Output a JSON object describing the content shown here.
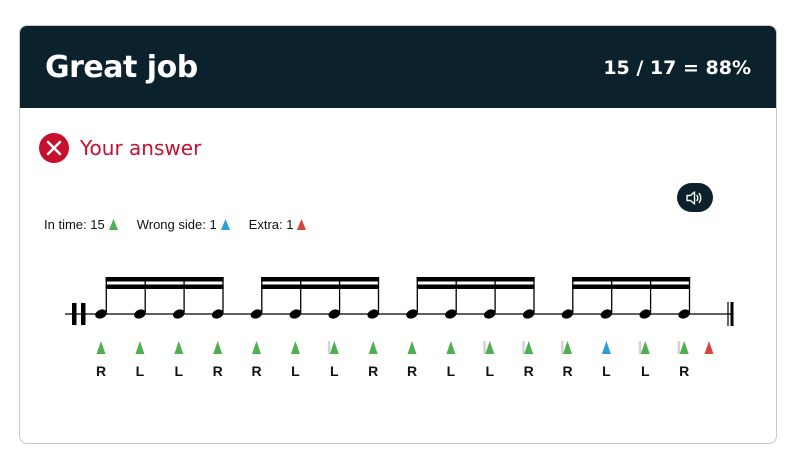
{
  "header": {
    "title": "Great job",
    "score": "15 / 17 = 88%"
  },
  "result": {
    "label": "Your answer",
    "status": "incorrect"
  },
  "legend": {
    "in_time": {
      "label": "In time: 15",
      "color": "#4caf50"
    },
    "wrong_side": {
      "label": "Wrong side: 1",
      "color": "#2a9fd6"
    },
    "extra": {
      "label": "Extra: 1",
      "color": "#d9453d"
    }
  },
  "sound_button": {
    "icon": "speaker-icon"
  },
  "colors": {
    "header_bg": "#0b212c",
    "error_red": "#c8102e",
    "in_time_green": "#4caf50",
    "wrong_side_blue": "#2a9fd6",
    "extra_red": "#d9453d"
  },
  "notation": {
    "beats": 4,
    "notes_per_beat": 4,
    "sticking": [
      "R",
      "L",
      "L",
      "R",
      "R",
      "L",
      "L",
      "R",
      "R",
      "L",
      "L",
      "R",
      "R",
      "L",
      "L",
      "R"
    ],
    "hits": [
      {
        "type": "in_time"
      },
      {
        "type": "in_time"
      },
      {
        "type": "in_time"
      },
      {
        "type": "in_time"
      },
      {
        "type": "in_time"
      },
      {
        "type": "in_time"
      },
      {
        "type": "in_time",
        "early": true
      },
      {
        "type": "in_time"
      },
      {
        "type": "in_time"
      },
      {
        "type": "in_time"
      },
      {
        "type": "in_time",
        "early": true
      },
      {
        "type": "in_time",
        "early": true
      },
      {
        "type": "in_time",
        "early": true
      },
      {
        "type": "wrong_side"
      },
      {
        "type": "in_time",
        "early": true
      },
      {
        "type": "in_time",
        "early": true
      },
      {
        "type": "extra"
      }
    ]
  }
}
